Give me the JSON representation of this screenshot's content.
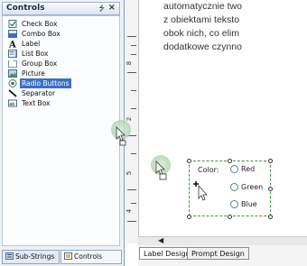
{
  "panel": {
    "title": "Controls",
    "pin_glyph": "⭍",
    "close_glyph": "×",
    "items": [
      {
        "label": "Check Box",
        "icon": "checkbox-icon"
      },
      {
        "label": "Combo Box",
        "icon": "combobox-icon"
      },
      {
        "label": "Label",
        "icon": "label-icon"
      },
      {
        "label": "List Box",
        "icon": "listbox-icon"
      },
      {
        "label": "Group Box",
        "icon": "groupbox-icon"
      },
      {
        "label": "Picture",
        "icon": "picture-icon"
      },
      {
        "label": "Radio Buttons",
        "icon": "radio-icon",
        "selected": true
      },
      {
        "label": "Separator",
        "icon": "separator-icon"
      },
      {
        "label": "Text Box",
        "icon": "textbox-icon"
      }
    ],
    "bottom_tabs": [
      {
        "label": "Sub-Strings"
      },
      {
        "label": "Controls"
      }
    ]
  },
  "document": {
    "lines": [
      "automatycznie two",
      "z obiektami teksto",
      "obok nich, co elim",
      "dodatkowe czynno"
    ],
    "ruler_numbers": [
      "8",
      "2",
      "5",
      "4"
    ]
  },
  "radio_group": {
    "label": "Color:",
    "options": [
      "Red",
      "Green",
      "Blue"
    ]
  },
  "doc_tabs": [
    {
      "label": "Label Design"
    },
    {
      "label": "Prompt Design"
    }
  ],
  "colors": {
    "accent": "#3b6fc9",
    "selection_border": "#3b9a3b"
  }
}
